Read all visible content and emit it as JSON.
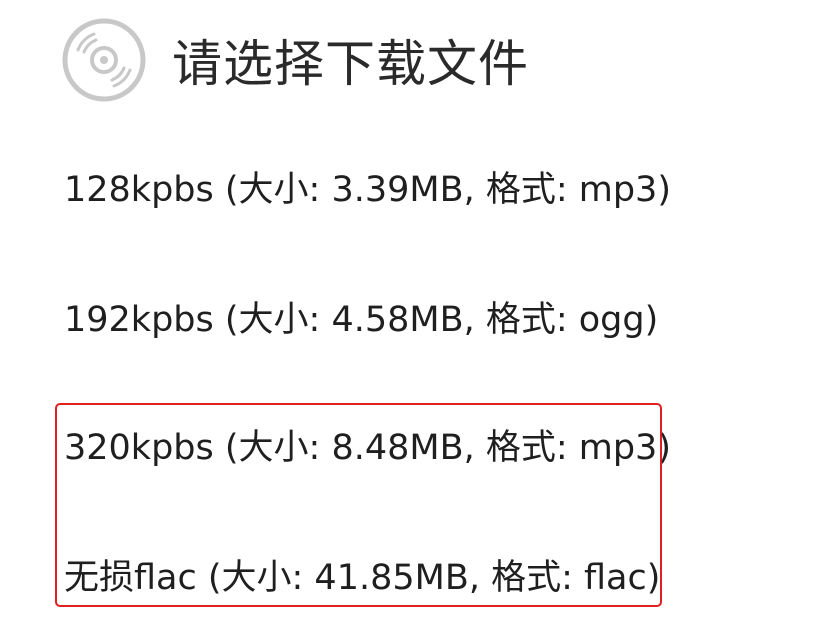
{
  "dialog": {
    "icon": "disc-icon",
    "title": "请选择下载文件"
  },
  "options": [
    {
      "label": "128kpbs (大小: 3.39MB, 格式: mp3)"
    },
    {
      "label": "192kpbs (大小: 4.58MB, 格式: ogg)"
    },
    {
      "label": "320kpbs (大小: 8.48MB, 格式: mp3)"
    },
    {
      "label": "无损flac (大小: 41.85MB, 格式: flac)"
    }
  ],
  "colors": {
    "highlight_border": "#e02020",
    "icon_gray": "#c8c8c8",
    "text": "#1f1f1f"
  }
}
